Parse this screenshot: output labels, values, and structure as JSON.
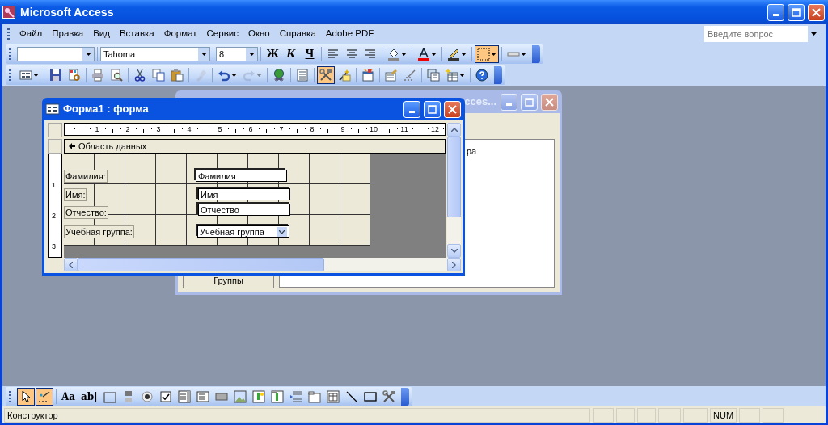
{
  "window": {
    "title": "Microsoft Access"
  },
  "menu": [
    {
      "label": "Файл"
    },
    {
      "label": "Правка"
    },
    {
      "label": "Вид"
    },
    {
      "label": "Вставка"
    },
    {
      "label": "Формат"
    },
    {
      "label": "Сервис"
    },
    {
      "label": "Окно"
    },
    {
      "label": "Справка"
    },
    {
      "label": "Adobe PDF"
    }
  ],
  "help_box": {
    "placeholder": "Введите вопрос"
  },
  "format_toolbar": {
    "font": "Tahoma",
    "size": "8",
    "text_buttons": [
      {
        "kind": "bold",
        "label": "Ж"
      },
      {
        "kind": "italic",
        "label": "К"
      },
      {
        "kind": "underline",
        "label": "Ч"
      }
    ],
    "tools": [
      {
        "kind": "align-left",
        "selected": false
      },
      {
        "kind": "align-center",
        "selected": false
      },
      {
        "kind": "align-right",
        "selected": false
      },
      {
        "kind": "fill",
        "selected": false
      },
      {
        "kind": "font-color",
        "selected": false
      },
      {
        "kind": "line-color",
        "selected": false
      },
      {
        "kind": "border",
        "selected": true
      },
      {
        "kind": "line-width",
        "selected": false
      }
    ]
  },
  "standard_toolbar": [
    {
      "kind": "view",
      "selected": false,
      "disabled": false
    },
    {
      "kind": "save",
      "selected": false,
      "disabled": false
    },
    {
      "kind": "file-search",
      "selected": false,
      "disabled": false
    },
    {
      "kind": "print",
      "selected": false,
      "disabled": false
    },
    {
      "kind": "preview",
      "selected": false,
      "disabled": false
    },
    {
      "kind": "cut",
      "selected": false,
      "disabled": false
    },
    {
      "kind": "copy",
      "selected": false,
      "disabled": false
    },
    {
      "kind": "paste",
      "selected": false,
      "disabled": false
    },
    {
      "kind": "brush",
      "selected": false,
      "disabled": true
    },
    {
      "kind": "undo",
      "selected": false,
      "disabled": false
    },
    {
      "kind": "redo",
      "selected": false,
      "disabled": true
    },
    {
      "kind": "globe",
      "selected": false,
      "disabled": false
    },
    {
      "kind": "list",
      "selected": false,
      "disabled": false
    },
    {
      "kind": "tools",
      "selected": true,
      "disabled": false
    },
    {
      "kind": "wand",
      "selected": false,
      "disabled": false
    },
    {
      "kind": "code",
      "selected": false,
      "disabled": false
    },
    {
      "kind": "properties",
      "selected": false,
      "disabled": false
    },
    {
      "kind": "build",
      "selected": false,
      "disabled": false
    },
    {
      "kind": "windows",
      "selected": false,
      "disabled": false
    },
    {
      "kind": "new-object",
      "selected": false,
      "disabled": false
    },
    {
      "kind": "help",
      "selected": false,
      "disabled": false
    }
  ],
  "back_window": {
    "title": "cces...",
    "text": "ра",
    "button": "Группы"
  },
  "form_window": {
    "title": "Форма1 : форма",
    "ruler": [
      "1",
      "2",
      "3",
      "4",
      "5",
      "6",
      "7",
      "8",
      "9",
      "10",
      "11",
      "12"
    ],
    "vruler": [
      "1",
      "2",
      "3"
    ],
    "section": "Область данных",
    "fields": [
      {
        "label": "Фамилия:",
        "control": "Фамилия",
        "kind": "textbox",
        "selected": true
      },
      {
        "label": "Имя:",
        "control": "Имя",
        "kind": "textbox",
        "selected": true
      },
      {
        "label": "Отчество:",
        "control": "Отчество",
        "kind": "textbox",
        "selected": true
      },
      {
        "label": "Учебная группа:",
        "control": "Учебная группа",
        "kind": "combo",
        "selected": true
      }
    ]
  },
  "toolbox": [
    {
      "kind": "pointer",
      "selected": true
    },
    {
      "kind": "wizard",
      "selected": true
    },
    {
      "kind": "label",
      "glyph": "Aa",
      "selected": false
    },
    {
      "kind": "textbox",
      "glyph": "ab|",
      "selected": false
    },
    {
      "kind": "group",
      "selected": false
    },
    {
      "kind": "toggle",
      "selected": false
    },
    {
      "kind": "radio",
      "selected": false
    },
    {
      "kind": "checkbox",
      "selected": false
    },
    {
      "kind": "combo",
      "selected": false
    },
    {
      "kind": "listbox",
      "selected": false
    },
    {
      "kind": "button",
      "selected": false
    },
    {
      "kind": "image",
      "selected": false
    },
    {
      "kind": "frame",
      "selected": false
    },
    {
      "kind": "bound-frame",
      "selected": false
    },
    {
      "kind": "page-break",
      "selected": false
    },
    {
      "kind": "tab",
      "selected": false
    },
    {
      "kind": "subform",
      "selected": false
    },
    {
      "kind": "line",
      "selected": false
    },
    {
      "kind": "rectangle",
      "selected": false
    },
    {
      "kind": "tools",
      "selected": false
    }
  ],
  "status_bar": {
    "mode": "Конструктор",
    "indicator": "NUM"
  }
}
